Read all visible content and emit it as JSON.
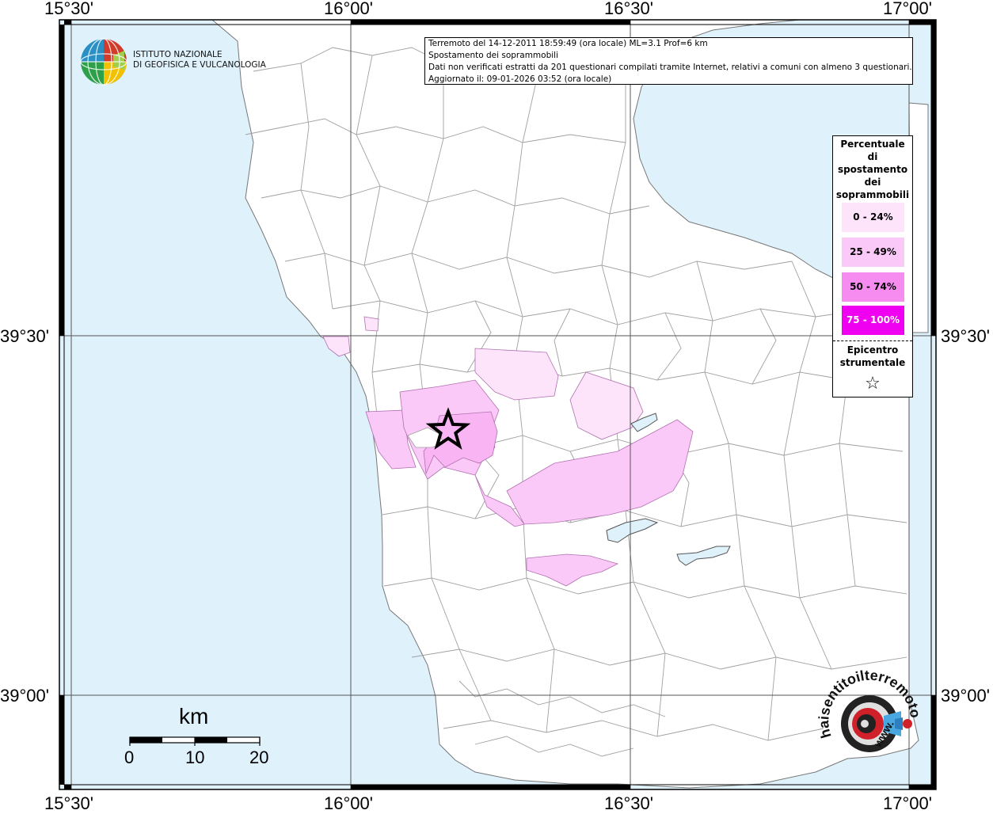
{
  "map": {
    "coord_labels": {
      "top": [
        "15°30'",
        "16°00'",
        "16°30'",
        "17°00'"
      ],
      "bottom": [
        "15°30'",
        "16°00'",
        "16°30'",
        "17°00'"
      ],
      "left": [
        "39°30'",
        "39°00'"
      ],
      "right": [
        "39°30'",
        "39°00'"
      ]
    },
    "colors": {
      "sea": "#dff1fb",
      "land": "#ffffff",
      "boundary": "#9a9a9a",
      "grid": "#555555",
      "class_0_24": "#fde4fb",
      "class_25_49": "#fbc9f7",
      "class_50_74": "#f68cf0",
      "class_75_100": "#f000f0"
    }
  },
  "info": {
    "line1": "Terremoto del 14-12-2011 18:59:49 (ora locale) ML=3.1 Prof=6 km",
    "line2": "Spostamento dei soprammobili",
    "line3": "Dati non verificati estratti da 201 questionari compilati tramite Internet, relativi a comuni con almeno 3 questionari.",
    "line4": "Aggiornato il: 09-01-2026 03:52 (ora locale)"
  },
  "legend": {
    "title_lines": [
      "Percentuale",
      "di",
      "spostamento",
      "dei",
      "soprammobili"
    ],
    "classes": [
      "0 - 24%",
      "25 - 49%",
      "50 - 74%",
      "75 - 100%"
    ],
    "epicenter_lines": [
      "Epicentro",
      "strumentale"
    ],
    "epicenter_symbol": "☆"
  },
  "logo_ingv": {
    "line1": "ISTITUTO NAZIONALE",
    "line2": "DI GEOFISICA E VULCANOLOGIA"
  },
  "scale": {
    "unit": "km",
    "labels": [
      "0",
      "10",
      "20"
    ]
  },
  "logo_hsit": {
    "arc_text": "haisentitoilterremoto.it",
    "bottom_text": "www."
  }
}
